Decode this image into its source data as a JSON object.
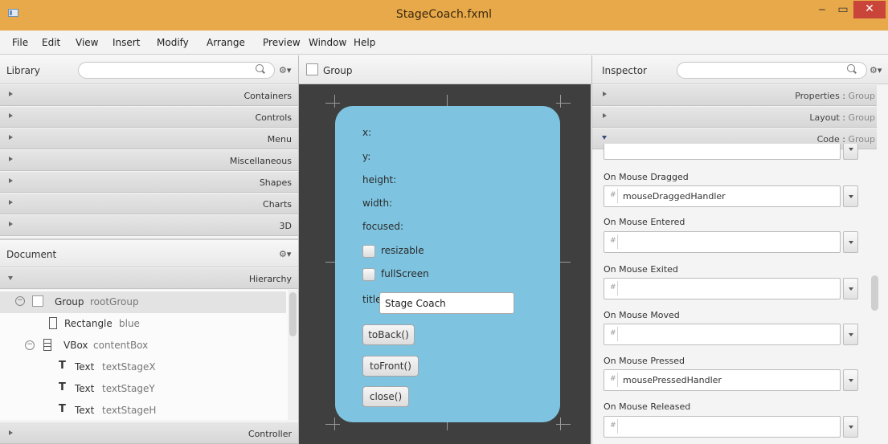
{
  "window": {
    "title": "StageCoach.fxml",
    "minimize_icon": "minimize-icon",
    "maximize_icon": "maximize-icon",
    "close_icon": "close-icon"
  },
  "menu": [
    "File",
    "Edit",
    "View",
    "Insert",
    "Modify",
    "Arrange",
    "Preview",
    "Window",
    "Help"
  ],
  "library": {
    "title": "Library",
    "gear": "⚙▾",
    "items": [
      "Containers",
      "Controls",
      "Menu",
      "Miscellaneous",
      "Shapes",
      "Charts",
      "3D"
    ]
  },
  "document": {
    "title": "Document",
    "gear": "⚙▾",
    "hierarchy_label": "Hierarchy",
    "controller_label": "Controller",
    "tree": [
      {
        "type": "Group",
        "name": "rootGroup"
      },
      {
        "type": "Rectangle",
        "name": "blue"
      },
      {
        "type": "VBox",
        "name": "contentBox"
      },
      {
        "type": "Text",
        "name": "textStageX"
      },
      {
        "type": "Text",
        "name": "textStageY"
      },
      {
        "type": "Text",
        "name": "textStageH"
      }
    ]
  },
  "content": {
    "breadcrumb": "Group",
    "labels": [
      "x:",
      "y:",
      "height:",
      "width:",
      "focused:"
    ],
    "checkboxes": [
      "resizable",
      "fullScreen"
    ],
    "title_label": "title",
    "title_value": "Stage Coach",
    "buttons": [
      "toBack()",
      "toFront()",
      "close()"
    ]
  },
  "inspector": {
    "title": "Inspector",
    "gear": "⚙▾",
    "sections": [
      {
        "name": "Properties",
        "sub": "Group"
      },
      {
        "name": "Layout",
        "sub": "Group"
      },
      {
        "name": "Code",
        "sub": "Group"
      }
    ],
    "events": [
      {
        "label": "On Mouse Dragged",
        "value": "mouseDraggedHandler"
      },
      {
        "label": "On Mouse Entered",
        "value": ""
      },
      {
        "label": "On Mouse Exited",
        "value": ""
      },
      {
        "label": "On Mouse Moved",
        "value": ""
      },
      {
        "label": "On Mouse Pressed",
        "value": "mousePressedHandler"
      },
      {
        "label": "On Mouse Released",
        "value": ""
      }
    ]
  },
  "colors": {
    "titlebar": "#e8a94a",
    "close": "#c9453a",
    "stage": "#7ec4e0",
    "canvas": "#3f3f3f"
  }
}
